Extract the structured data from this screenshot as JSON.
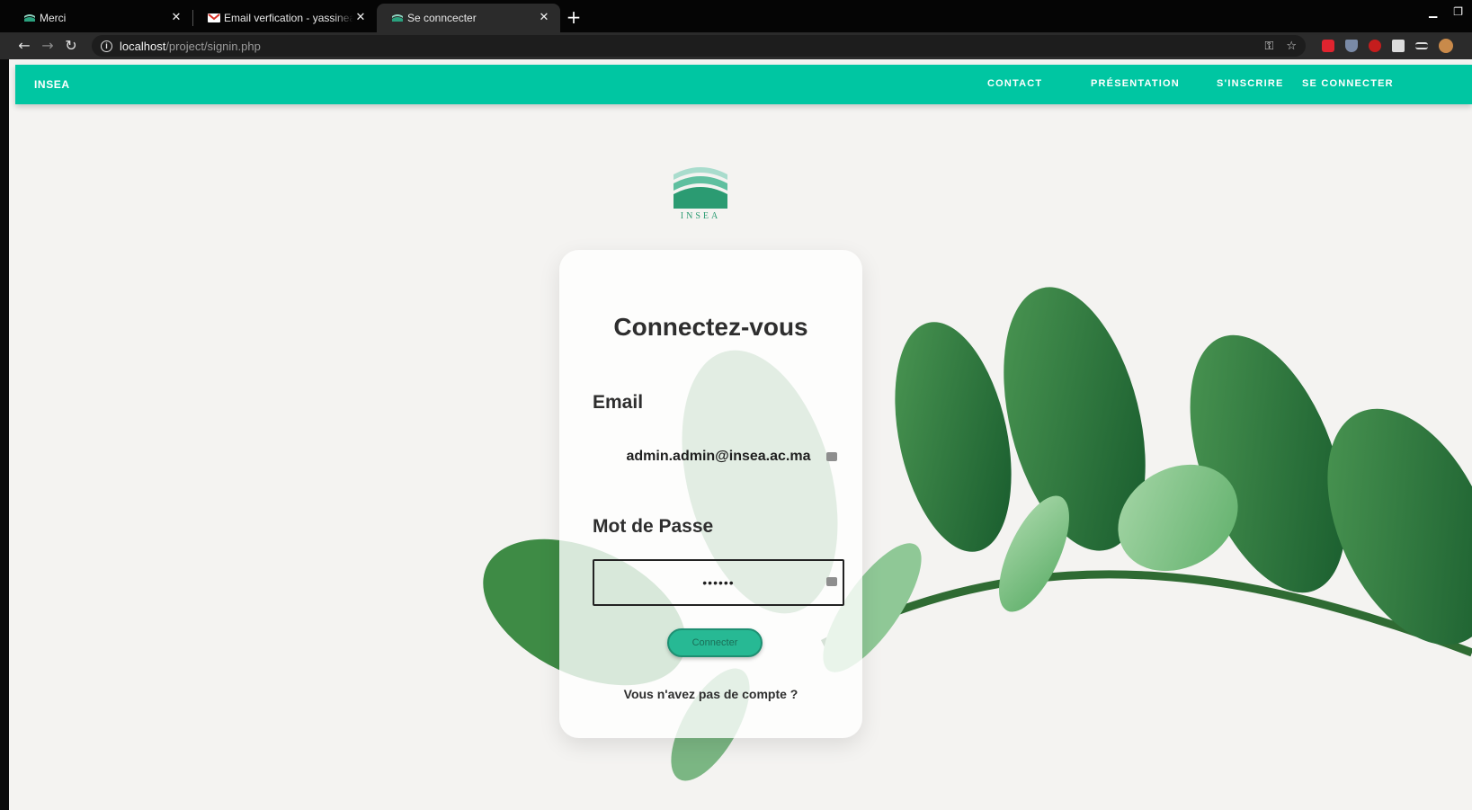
{
  "browser": {
    "tabs": [
      {
        "title": "Merci",
        "active": false
      },
      {
        "title": "Email verfication - yassineaitm",
        "active": false
      },
      {
        "title": "Se conncecter",
        "active": true
      }
    ],
    "url_host": "localhost",
    "url_path": "/project/signin.php"
  },
  "navbar": {
    "brand": "INSEA",
    "links": [
      "CONTACT",
      "PRÉSENTATION",
      "S'INSCRIRE",
      "SE CONNECTER"
    ]
  },
  "logo": {
    "text": "INSEA"
  },
  "login": {
    "title": "Connectez-vous",
    "email_label": "Email",
    "email_value": "admin.admin@insea.ac.ma",
    "password_label": "Mot de Passe",
    "password_value": "••••••",
    "submit_label": "Connecter",
    "signup_text": "Vous n'avez pas de compte ?"
  },
  "colors": {
    "navbar": "#00c6a2",
    "button": "#27b994",
    "title_text": "#2e2e2e"
  }
}
